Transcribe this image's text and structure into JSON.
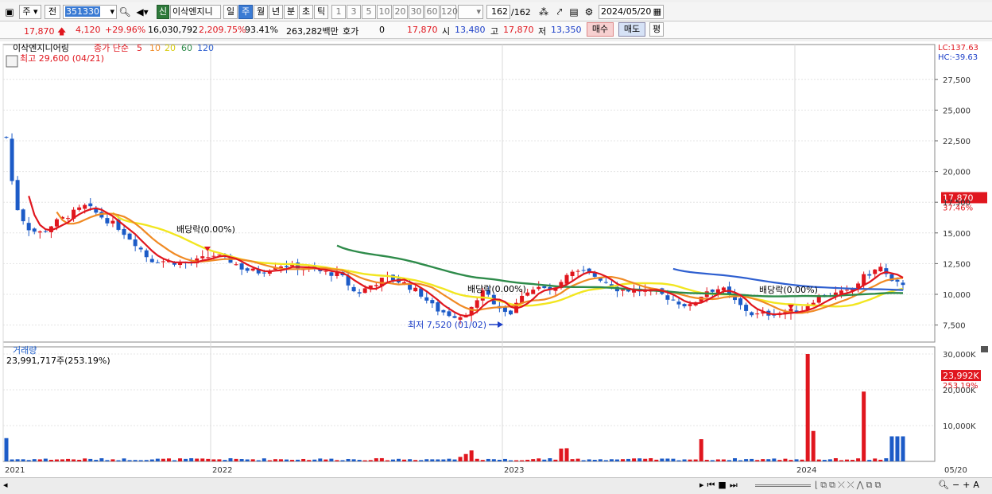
{
  "toolbar": {
    "market": "주",
    "prev_label": "전",
    "code": "351330",
    "stock_name": "이삭엔지니",
    "tag_new": "신",
    "periods": [
      "일",
      "주",
      "월",
      "년",
      "분",
      "초",
      "틱"
    ],
    "active_period": "주",
    "intervals": [
      "1",
      "3",
      "5",
      "10",
      "20",
      "30",
      "60",
      "120"
    ],
    "count": "162",
    "count_total": "/162",
    "date": "2024/05/20"
  },
  "quote": {
    "price": "17,870",
    "change": "4,120",
    "change_pct": "+29.96%",
    "volume": "16,030,792",
    "volume_pct": "2,209.75%",
    "rate": "93.41%",
    "amount": "263,282백만",
    "hoga_label": "호가",
    "hoga_value": "0",
    "hoga_price": "17,870",
    "open_label": "시",
    "open": "13,480",
    "high_label": "고",
    "high": "17,870",
    "low_label": "저",
    "low": "13,350",
    "buy_label": "매수",
    "sell_label": "매도",
    "eval_label": "평"
  },
  "colors": {
    "up": "#e0161e",
    "down": "#1c5bc7",
    "ma5": "#e0161e",
    "ma10": "#f08a24",
    "ma20": "#f2e620",
    "ma60": "#2e8b4a",
    "ma120": "#2e5fd0"
  },
  "price_panel": {
    "name": "이삭엔지니어링",
    "ma_label": "종가 단순",
    "ma_periods": [
      "5",
      "10",
      "20",
      "60",
      "120"
    ],
    "max_label": "최고 29,600 (04/21)",
    "min_label": "최저 7,520 (01/02)",
    "dividend_labels": [
      "배당락(0.00%)",
      "배당락(0.00%)",
      "배당락(0.00%)"
    ],
    "lc": "LC:137.63",
    "hc": "HC:-39.63",
    "last_price": "17,870",
    "last_pct": "37.46%",
    "y_ticks": [
      "27,500",
      "25,000",
      "22,500",
      "20,000",
      "17,500",
      "15,000",
      "12,500",
      "10,000",
      "7,500"
    ]
  },
  "volume_panel": {
    "name": "거래량",
    "info": "23,991,717주(253.19%)",
    "y_ticks": [
      "30,000K",
      "20,000K",
      "10,000K"
    ],
    "last_vol": "23,992K",
    "last_pct": "253.19%"
  },
  "x_axis": [
    "2021",
    "2022",
    "2023",
    "2024",
    "05/20"
  ]
}
